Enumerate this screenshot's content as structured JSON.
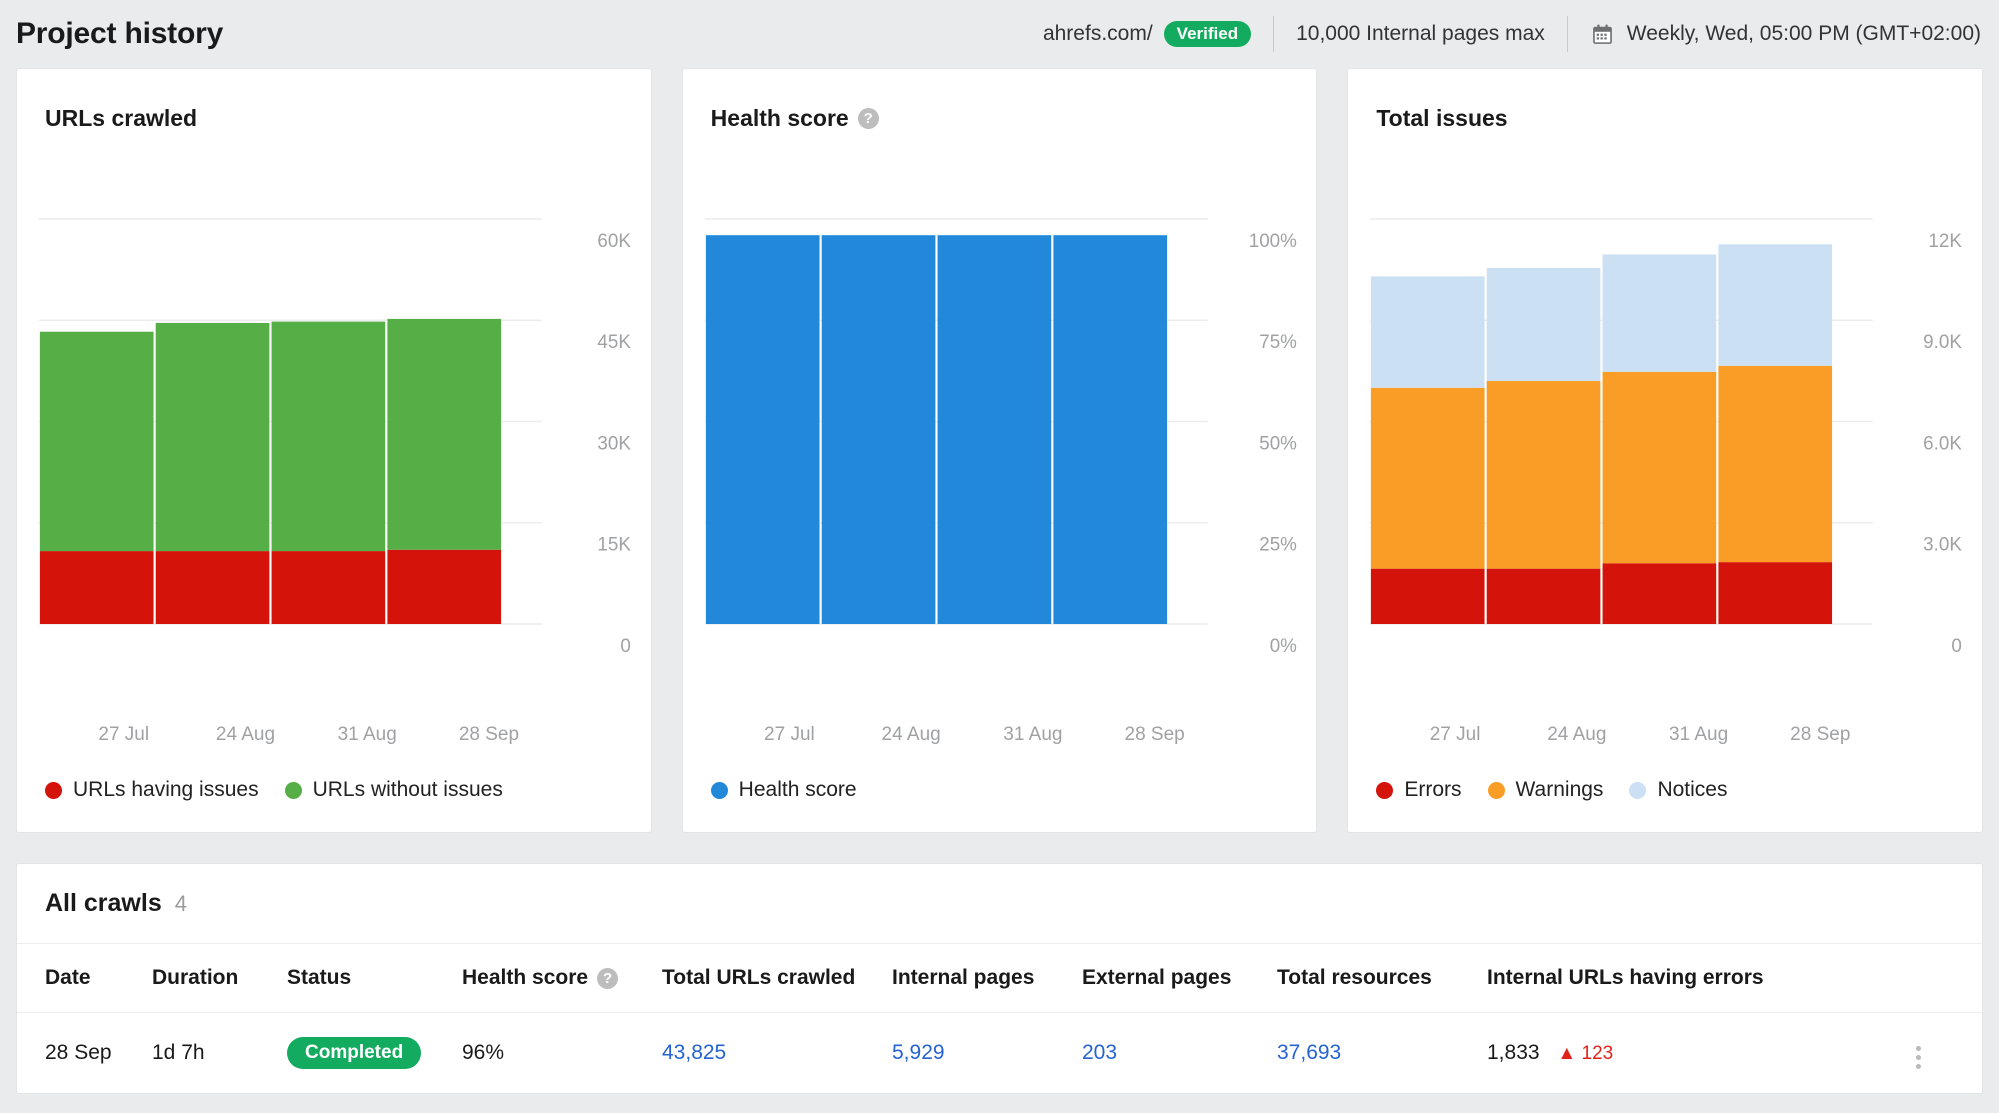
{
  "header": {
    "title": "Project history",
    "domain": "ahrefs.com/",
    "verified_label": "Verified",
    "pages_max": "10,000 Internal pages max",
    "schedule": "Weekly, Wed, 05:00 PM (GMT+02:00)",
    "calendar_icon": "calendar-icon"
  },
  "colors": {
    "green": "#56ae46",
    "red": "#d4140a",
    "blue": "#2288d9",
    "orange": "#f99d27",
    "light_blue": "#cbe0f3",
    "status_green": "#13ab5f",
    "link_blue": "#2463d1",
    "delta_red": "#e2231a"
  },
  "cards": [
    {
      "title": "URLs crawled",
      "has_help": false,
      "legend": [
        {
          "label": "URLs having issues",
          "color": "#d4140a"
        },
        {
          "label": "URLs without issues",
          "color": "#56ae46"
        }
      ]
    },
    {
      "title": "Health score",
      "has_help": true,
      "help_icon": "question-mark-icon",
      "legend": [
        {
          "label": "Health score",
          "color": "#2288d9"
        }
      ]
    },
    {
      "title": "Total issues",
      "has_help": false,
      "legend": [
        {
          "label": "Errors",
          "color": "#d4140a"
        },
        {
          "label": "Warnings",
          "color": "#f99d27"
        },
        {
          "label": "Notices",
          "color": "#cbe0f3"
        }
      ]
    }
  ],
  "chart_data": [
    {
      "type": "bar",
      "title": "URLs crawled",
      "stacked": true,
      "categories": [
        "27 Jul",
        "24 Aug",
        "31 Aug",
        "28 Sep"
      ],
      "series": [
        {
          "name": "URLs having issues",
          "color": "#d4140a",
          "values": [
            10800,
            10800,
            10800,
            11000
          ]
        },
        {
          "name": "URLs without issues",
          "color": "#56ae46",
          "values": [
            32500,
            33800,
            34000,
            34200
          ]
        }
      ],
      "ytick_labels": [
        "60K",
        "45K",
        "30K",
        "15K",
        "0"
      ],
      "ytick_values": [
        60000,
        45000,
        30000,
        15000,
        0
      ],
      "ylim": [
        0,
        60000
      ],
      "xlabel": "",
      "ylabel": "",
      "grid": true,
      "legend_position": "bottom-left"
    },
    {
      "type": "bar",
      "title": "Health score",
      "stacked": false,
      "categories": [
        "27 Jul",
        "24 Aug",
        "31 Aug",
        "28 Sep"
      ],
      "series": [
        {
          "name": "Health score",
          "color": "#2288d9",
          "values": [
            96,
            96,
            96,
            96
          ]
        }
      ],
      "ytick_labels": [
        "100%",
        "75%",
        "50%",
        "25%",
        "0%"
      ],
      "ytick_values": [
        100,
        75,
        50,
        25,
        0
      ],
      "ylim": [
        0,
        100
      ],
      "xlabel": "",
      "ylabel": "",
      "grid": true,
      "legend_position": "bottom-left"
    },
    {
      "type": "bar",
      "title": "Total issues",
      "stacked": true,
      "categories": [
        "27 Jul",
        "24 Aug",
        "31 Aug",
        "28 Sep"
      ],
      "series": [
        {
          "name": "Errors",
          "color": "#d4140a",
          "values": [
            1640,
            1640,
            1800,
            1833
          ]
        },
        {
          "name": "Warnings",
          "color": "#f99d27",
          "values": [
            5360,
            5560,
            5670,
            5817
          ]
        },
        {
          "name": "Notices",
          "color": "#cbe0f3",
          "values": [
            3300,
            3350,
            3480,
            3600
          ]
        }
      ],
      "ytick_labels": [
        "12K",
        "9.0K",
        "6.0K",
        "3.0K",
        "0"
      ],
      "ytick_values": [
        12000,
        9000,
        6000,
        3000,
        0
      ],
      "ylim": [
        0,
        12000
      ],
      "xlabel": "",
      "ylabel": "",
      "grid": true,
      "legend_position": "bottom-left"
    }
  ],
  "crawls": {
    "title": "All crawls",
    "count": "4",
    "columns": [
      {
        "label": "Date",
        "help": false
      },
      {
        "label": "Duration",
        "help": false
      },
      {
        "label": "Status",
        "help": false
      },
      {
        "label": "Health score",
        "help": true
      },
      {
        "label": "Total URLs crawled",
        "help": false
      },
      {
        "label": "Internal pages",
        "help": false
      },
      {
        "label": "External pages",
        "help": false
      },
      {
        "label": "Total resources",
        "help": false
      },
      {
        "label": "Internal URLs having errors",
        "help": false
      }
    ],
    "rows": [
      {
        "date": "28 Sep",
        "duration": "1d 7h",
        "status": "Completed",
        "health_score": "96%",
        "total_urls_crawled": "43,825",
        "internal_pages": "5,929",
        "external_pages": "203",
        "total_resources": "37,693",
        "internal_urls_having_errors": "1,833",
        "errors_delta": "123",
        "errors_delta_dir": "up",
        "menu_icon": "kebab-menu-icon"
      }
    ]
  }
}
